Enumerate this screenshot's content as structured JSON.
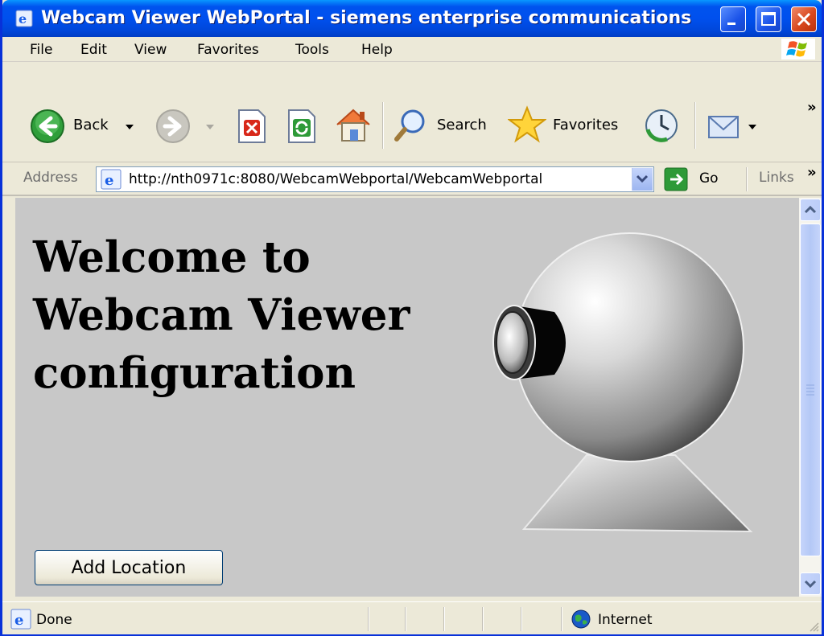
{
  "window": {
    "title": "Webcam Viewer WebPortal - siemens enterprise communications"
  },
  "menu": {
    "items": [
      {
        "label": "File"
      },
      {
        "label": "Edit"
      },
      {
        "label": "View"
      },
      {
        "label": "Favorites"
      },
      {
        "label": "Tools"
      },
      {
        "label": "Help"
      }
    ]
  },
  "toolbar": {
    "back_label": "Back",
    "search_label": "Search",
    "favorites_label": "Favorites",
    "overflow_label": "»"
  },
  "address": {
    "label": "Address",
    "url": "http://nth0971c:8080/WebcamWebportal/WebcamWebportal",
    "go_label": "Go",
    "links_label": "Links",
    "links_overflow": "»"
  },
  "page": {
    "heading_line1": "Welcome to",
    "heading_line2": "Webcam Viewer",
    "heading_line3": "configuration",
    "add_location_label": "Add Location"
  },
  "status": {
    "text": "Done",
    "zone": "Internet"
  },
  "colors": {
    "titlebar": "#0053ee",
    "content_bg": "#c8c8c8",
    "chrome": "#ece9d8"
  }
}
